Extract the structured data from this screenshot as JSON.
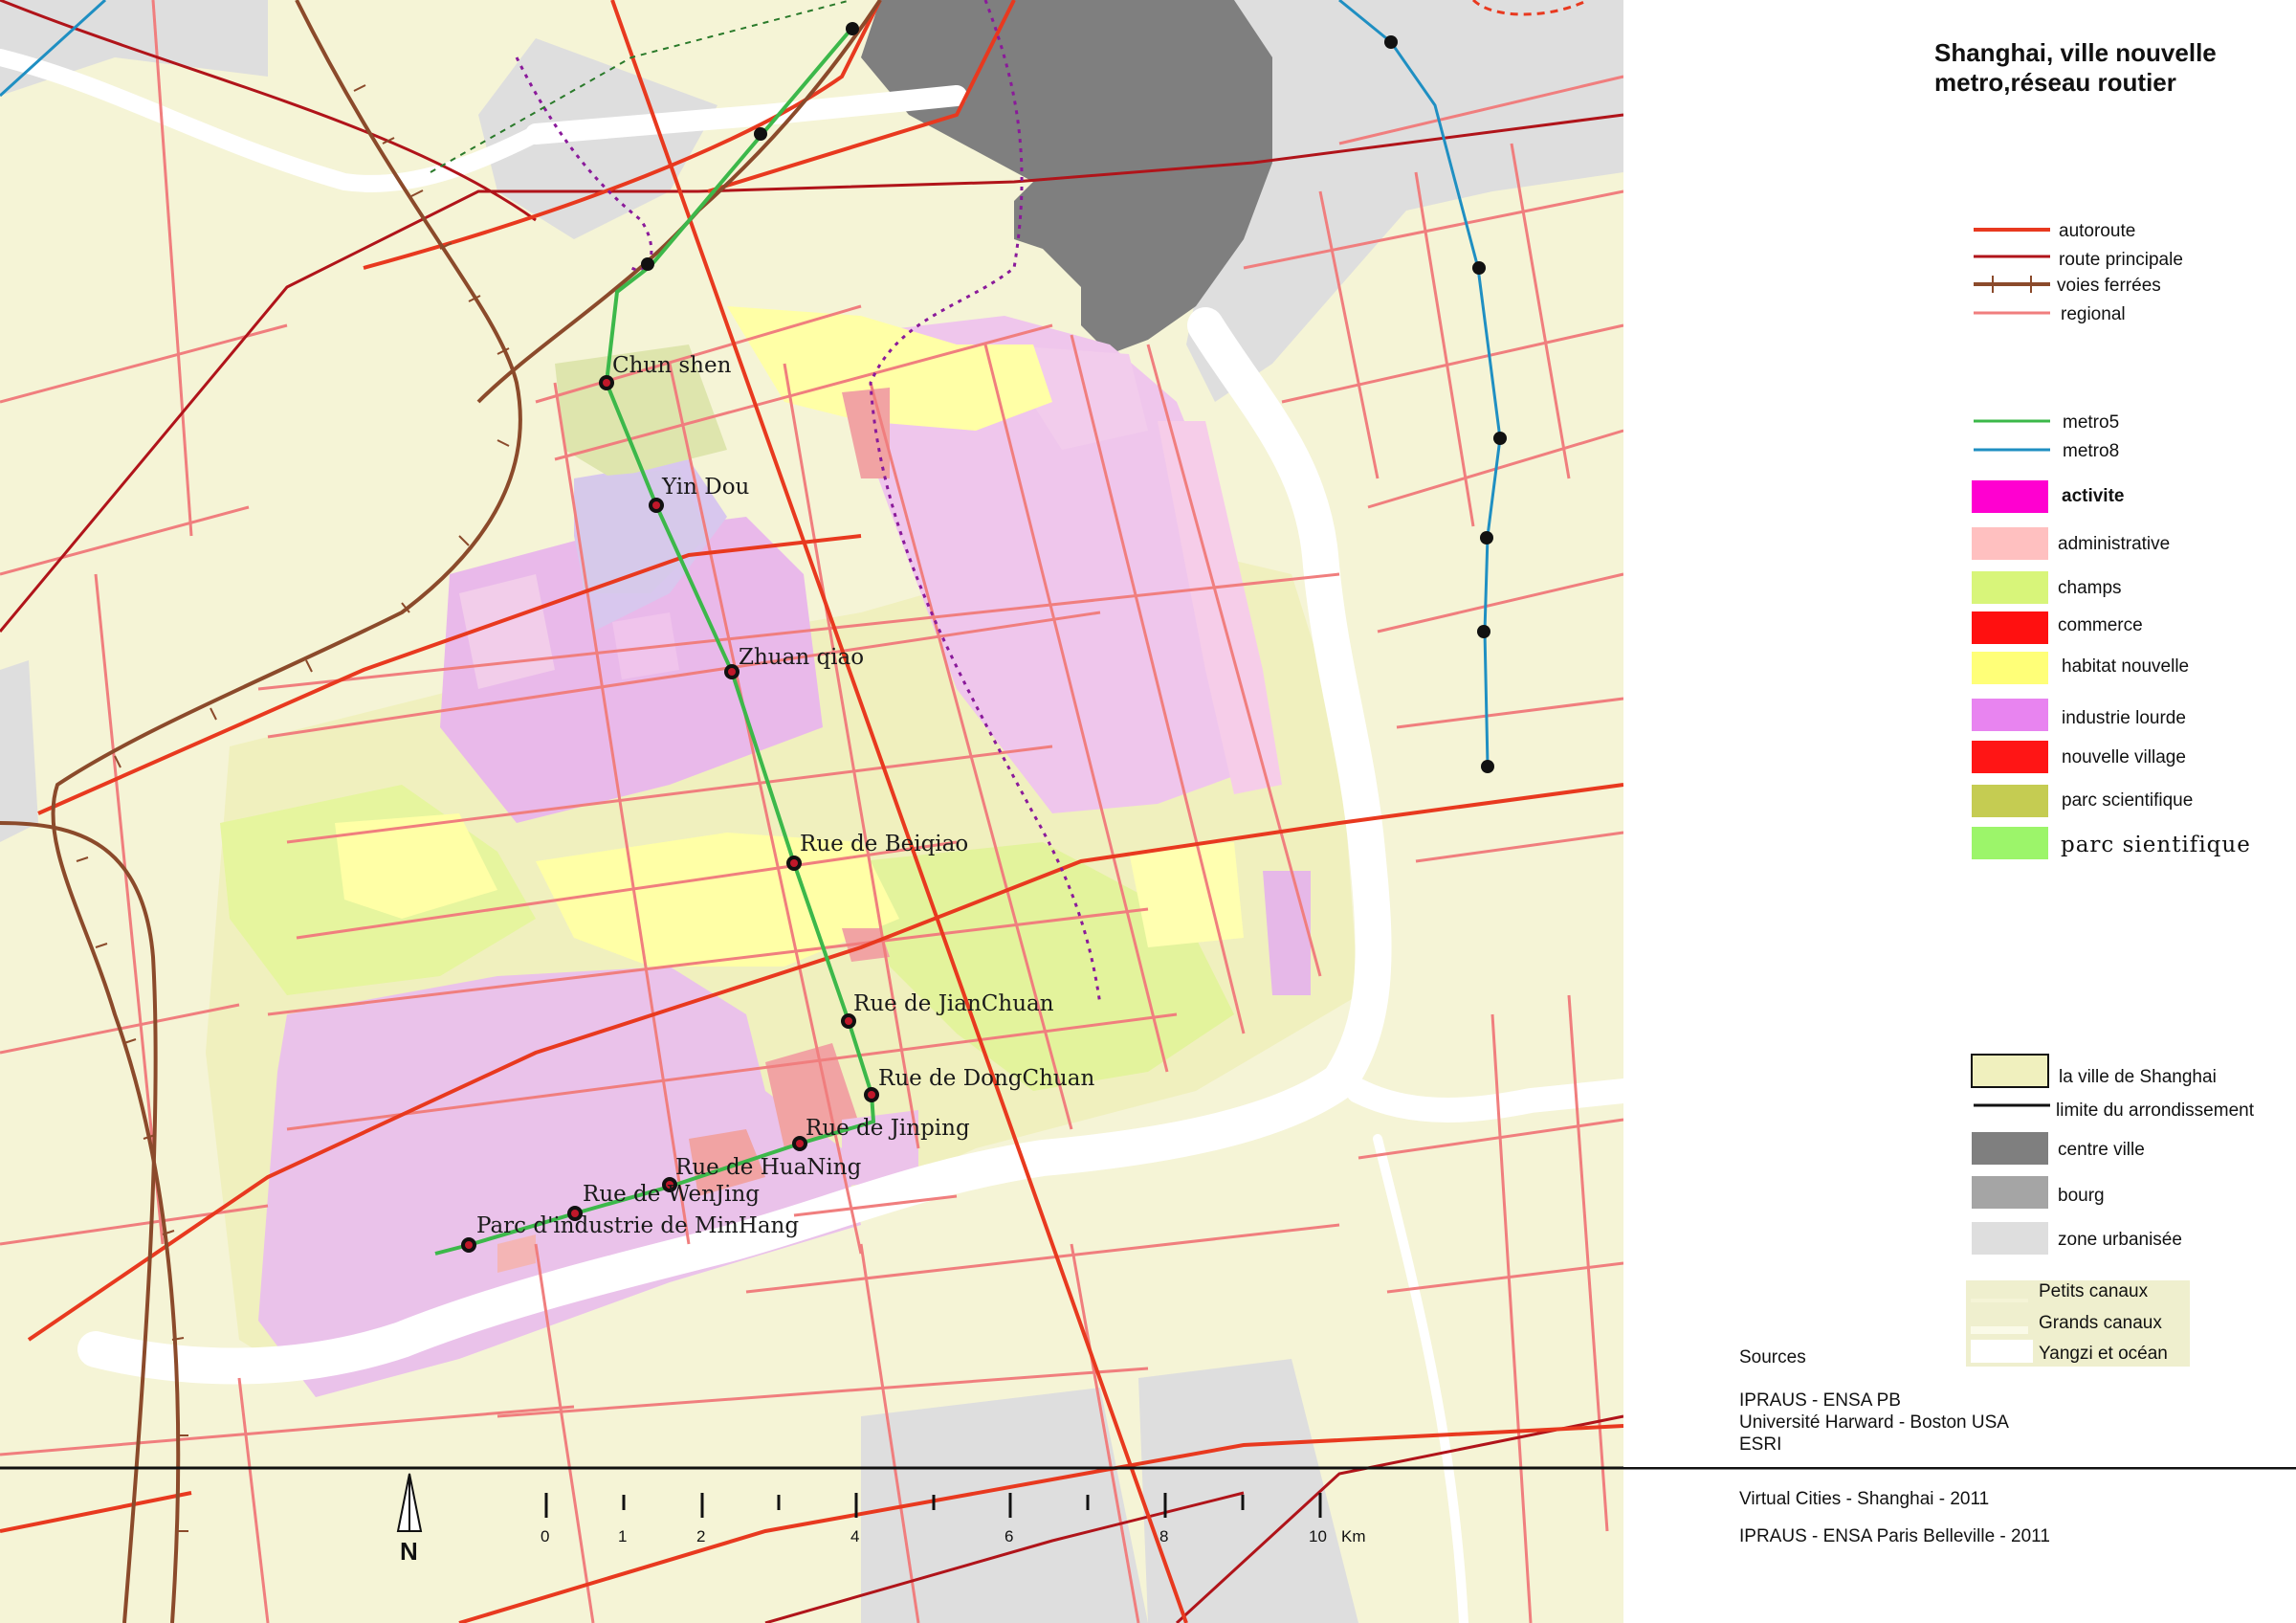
{
  "title": {
    "line1": "Shanghai, ville nouvelle",
    "line2": "metro,réseau routier"
  },
  "colors": {
    "background_land": "#f5f4d6",
    "urban_zone": "#dedede",
    "city_center": "#7f7f7f",
    "river": "#ffffff",
    "autoroute": "#e8391f",
    "route_principale": "#b0141a",
    "voies_ferrees": "#8b4a2b",
    "regional": "#f07e7e",
    "metro5": "#3cb84a",
    "metro8": "#1f8fc2",
    "activite": "#ff00d0",
    "administrative": "#ffc0c0",
    "champs": "#d8f57a",
    "commerce": "#ff1010",
    "habitat_nouvelle": "#ffff78",
    "industrie_lourde": "#e884f0",
    "nouvelle_village": "#ff1515",
    "parc_scientifique": "#c5cc52",
    "parc_sientifique": "#9cf56a",
    "ville_de_shanghai": "#f0f0be",
    "bourg": "#a5a5a5",
    "zone_urbanisee": "#dedede"
  },
  "legend": {
    "lines": [
      {
        "label": "autoroute",
        "color": "#e8391f",
        "kind": "line"
      },
      {
        "label": "route principale",
        "color": "#b0141a",
        "kind": "line"
      },
      {
        "label": "voies ferrées",
        "color": "#8b4a2b",
        "kind": "rail"
      },
      {
        "label": "regional",
        "color": "#f07e7e",
        "kind": "line"
      }
    ],
    "metros": [
      {
        "label": "metro5",
        "color": "#3cb84a"
      },
      {
        "label": "metro8",
        "color": "#1f8fc2"
      }
    ],
    "landuse": [
      {
        "label": "activite",
        "color": "#ff00d0",
        "bold": true
      },
      {
        "label": "administrative",
        "color": "#ffc0c0"
      },
      {
        "label": "champs",
        "color": "#d8f57a"
      },
      {
        "label": "commerce",
        "color": "#ff1010"
      },
      {
        "label": "habitat nouvelle",
        "color": "#ffff78"
      },
      {
        "label": "industrie lourde",
        "color": "#e884f0"
      },
      {
        "label": "nouvelle village",
        "color": "#ff1515"
      },
      {
        "label": "parc scientifique",
        "color": "#c5cc52"
      },
      {
        "label": "parc sientifique",
        "color": "#9cf56a",
        "serif": true
      }
    ],
    "base": [
      {
        "label": "la ville de Shanghai",
        "color": "#f0f0be",
        "kind": "box"
      },
      {
        "label": "limite du arrondissement",
        "color": "#111111",
        "kind": "line"
      },
      {
        "label": "centre ville",
        "color": "#7f7f7f",
        "kind": "box"
      },
      {
        "label": "bourg",
        "color": "#a5a5a5",
        "kind": "box"
      },
      {
        "label": "zone urbanisée",
        "color": "#dedede",
        "kind": "box"
      }
    ],
    "water": [
      {
        "label": "Petits canaux"
      },
      {
        "label": "Grands canaux"
      },
      {
        "label": "Yangzi et océan"
      }
    ]
  },
  "stations": [
    {
      "label": "Chun shen"
    },
    {
      "label": "Yin Dou"
    },
    {
      "label": "Zhuan qiao"
    },
    {
      "label": "Rue de Beiqiao"
    },
    {
      "label": "Rue de JianChuan"
    },
    {
      "label": "Rue de DongChuan"
    },
    {
      "label": "Rue de Jinping"
    },
    {
      "label": "Rue de HuaNing"
    },
    {
      "label": "Rue de WenJing"
    },
    {
      "label": "Parc d'industrie de MinHang"
    }
  ],
  "sources": {
    "heading": "Sources",
    "line1": "IPRAUS - ENSA PB",
    "line2": "Université Harward - Boston USA",
    "line3": "ESRI"
  },
  "footer": {
    "line1": "Virtual Cities - Shanghai - 2011",
    "line2": "IPRAUS - ENSA Paris Belleville - 2011"
  },
  "scale": {
    "ticks": [
      "0",
      "1",
      "2",
      "4",
      "6",
      "8",
      "10"
    ],
    "unit": "Km"
  },
  "north": "N"
}
